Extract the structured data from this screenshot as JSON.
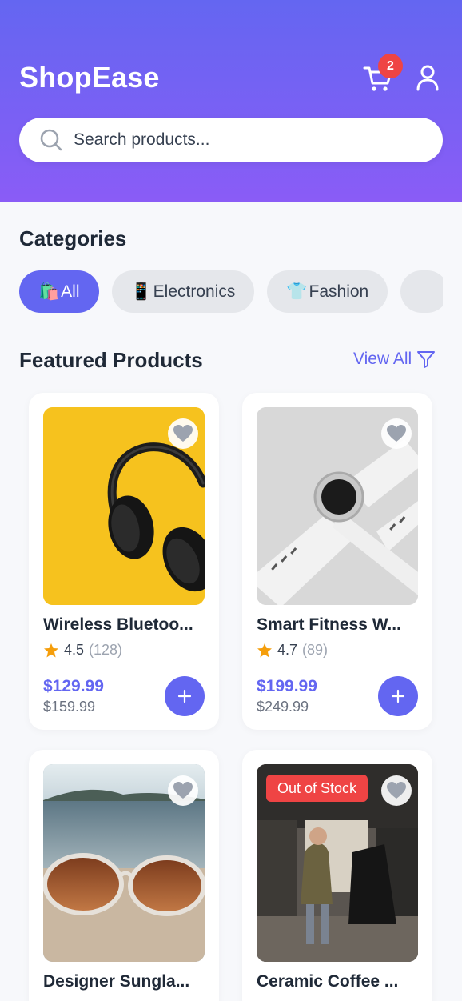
{
  "header": {
    "brand": "ShopEase",
    "cart_count": "2",
    "search_placeholder": "Search products..."
  },
  "categories": {
    "title": "Categories",
    "items": [
      {
        "emoji": "🛍️",
        "label": "All",
        "active": true
      },
      {
        "emoji": "📱",
        "label": "Electronics",
        "active": false
      },
      {
        "emoji": "👕",
        "label": "Fashion",
        "active": false
      }
    ]
  },
  "featured": {
    "title": "Featured Products",
    "view_all": "View All"
  },
  "products": [
    {
      "name": "Wireless Bluetoo...",
      "rating": "4.5",
      "reviews": "(128)",
      "price": "$129.99",
      "old_price": "$159.99"
    },
    {
      "name": "Smart Fitness W...",
      "rating": "4.7",
      "reviews": "(89)",
      "price": "$199.99",
      "old_price": "$249.99"
    },
    {
      "name": "Designer Sungla...",
      "badge": ""
    },
    {
      "name": "Ceramic Coffee ...",
      "badge": "Out of Stock"
    }
  ],
  "colors": {
    "primary": "#6366f1",
    "header_gradient_top": "#6466f1",
    "header_gradient_bottom": "#8a5cf6",
    "badge_red": "#ef4444",
    "star": "#f59e0b"
  },
  "icons": [
    "cart-icon",
    "user-icon",
    "search-icon",
    "filter-icon",
    "heart-icon",
    "star-icon",
    "plus-icon"
  ]
}
